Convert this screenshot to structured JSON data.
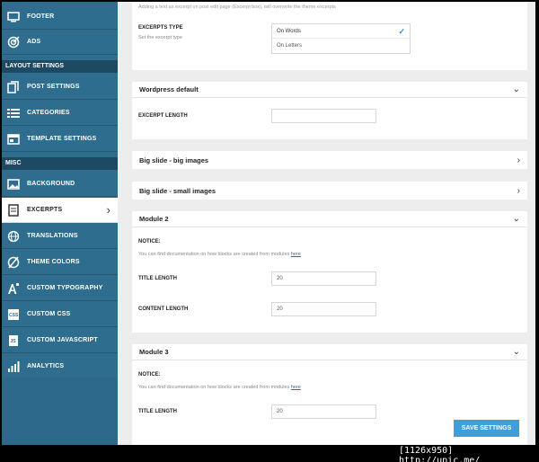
{
  "sidebar": {
    "items_top": [
      {
        "label": "FOOTER",
        "icon": "monitor-icon"
      },
      {
        "label": "ADS",
        "icon": "target-icon"
      }
    ],
    "section_layout": "LAYOUT SETTINGS",
    "items_layout": [
      {
        "label": "POST SETTINGS",
        "icon": "copy-icon"
      },
      {
        "label": "CATEGORIES",
        "icon": "list-icon"
      },
      {
        "label": "TEMPLATE SETTINGS",
        "icon": "window-icon"
      }
    ],
    "section_misc": "MISC",
    "items_misc": [
      {
        "label": "BACKGROUND",
        "icon": "image-icon"
      },
      {
        "label": "EXCERPTS",
        "icon": "document-icon",
        "active": true
      },
      {
        "label": "TRANSLATIONS",
        "icon": "globe-icon"
      },
      {
        "label": "THEME COLORS",
        "icon": "palette-icon"
      },
      {
        "label": "CUSTOM TYPOGRAPHY",
        "icon": "typography-icon"
      },
      {
        "label": "CUSTOM CSS",
        "icon": "css-file-icon"
      },
      {
        "label": "CUSTOM JAVASCRIPT",
        "icon": "js-file-icon"
      },
      {
        "label": "ANALYTICS",
        "icon": "bar-chart-icon"
      }
    ]
  },
  "top_panel": {
    "intro_text": "Adding a text as excerpt on post edit page (Excerpt box), will overwrite the theme excerpts",
    "excerpts_type_label": "EXCERPTS TYPE",
    "excerpts_type_sub": "Set the excerpt type",
    "options": [
      "On Words",
      "On Letters"
    ],
    "selected": "On Words"
  },
  "wordpress_panel": {
    "title": "Wordpress default",
    "excerpt_length_label": "EXCERPT LENGTH",
    "excerpt_length_value": ""
  },
  "big_slide_big": {
    "title": "Big slide - big images"
  },
  "big_slide_small": {
    "title": "Big slide - small images"
  },
  "module2": {
    "title": "Module 2",
    "notice_label": "NOTICE:",
    "notice_text": "You can find documentation on how blocks are created from modules",
    "notice_link": "here",
    "title_length_label": "TITLE LENGTH",
    "title_length_value": "20",
    "content_length_label": "CONTENT LENGTH",
    "content_length_value": "20"
  },
  "module3": {
    "title": "Module 3",
    "notice_label": "NOTICE:",
    "notice_text": "You can find documentation on how blocks are created from modules",
    "notice_link": "here",
    "title_length_label": "TITLE LENGTH",
    "title_length_value": "20"
  },
  "save_button": "SAVE SETTINGS",
  "watermark": "[1126x950] http://upic.me/"
}
